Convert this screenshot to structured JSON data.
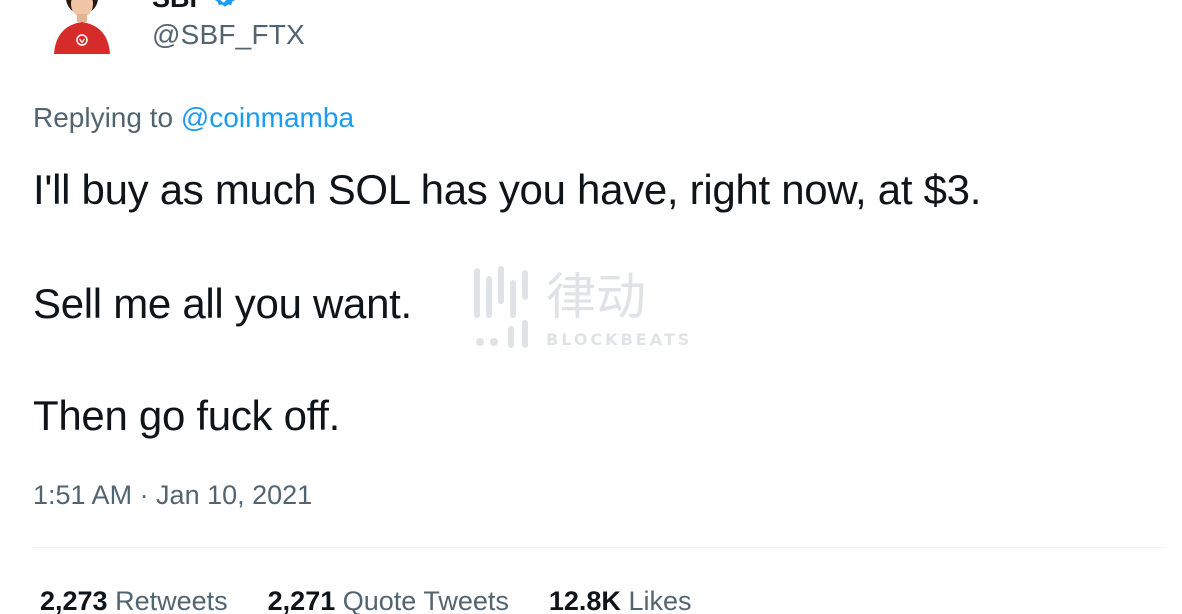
{
  "author": {
    "display_name": "SBF",
    "handle": "@SBF_FTX",
    "verified": true
  },
  "reply": {
    "prefix": "Replying to ",
    "mention": "@coinmamba"
  },
  "tweet": {
    "lines": [
      "I'll buy as much SOL has you have, right now, at $3.",
      "Sell me all you want.",
      "Then go fuck off."
    ],
    "timestamp": "1:51 AM · Jan 10, 2021"
  },
  "stats": {
    "retweets_count": "2,273",
    "retweets_label": "Retweets",
    "quotes_count": "2,271",
    "quotes_label": "Quote Tweets",
    "likes_count": "12.8K",
    "likes_label": "Likes"
  },
  "watermark": {
    "logo_text": "律动",
    "brand": "BLOCKBEATS"
  },
  "colors": {
    "text": "#0f1419",
    "secondary": "#536471",
    "link": "#1d9bf0",
    "verified": "#1d9bf0",
    "avatar_shirt": "#d62b2b"
  }
}
